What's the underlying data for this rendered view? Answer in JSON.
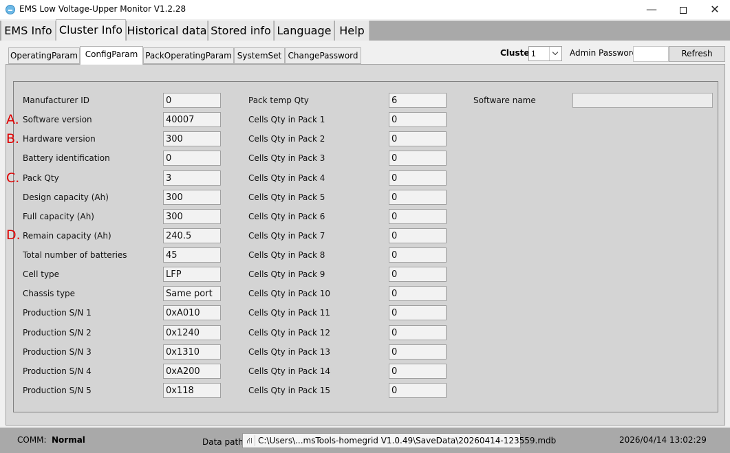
{
  "window": {
    "title": "EMS Low Voltage-Upper Monitor V1.2.28",
    "minimize_glyph": "—",
    "close_glyph": "✕"
  },
  "main_tabs": [
    {
      "label": "EMS Info"
    },
    {
      "label": "Cluster Info"
    },
    {
      "label": "Historical data"
    },
    {
      "label": "Stored info"
    },
    {
      "label": "Language"
    },
    {
      "label": "Help"
    }
  ],
  "sub_tabs": [
    {
      "label": "OperatingParam"
    },
    {
      "label": "ConfigParam"
    },
    {
      "label": "PackOperatingParam"
    },
    {
      "label": "SystemSet"
    },
    {
      "label": "ChangePassword"
    }
  ],
  "controls": {
    "cluster_label": "Cluster",
    "cluster_value": "1",
    "admin_label": "Admin Password",
    "admin_value": "",
    "refresh_label": "Refresh"
  },
  "left_fields": [
    {
      "label": "Manufacturer ID",
      "value": "0"
    },
    {
      "label": "Software version",
      "value": "40007"
    },
    {
      "label": "Hardware version",
      "value": "300"
    },
    {
      "label": "Battery identification",
      "value": "0"
    },
    {
      "label": "Pack Qty",
      "value": "3"
    },
    {
      "label": "Design capacity (Ah)",
      "value": "300"
    },
    {
      "label": "Full capacity (Ah)",
      "value": "300"
    },
    {
      "label": "Remain capacity (Ah)",
      "value": "240.5"
    },
    {
      "label": "Total number of batteries",
      "value": "45"
    },
    {
      "label": "Cell type",
      "value": "LFP"
    },
    {
      "label": "Chassis type",
      "value": "Same port"
    },
    {
      "label": "Production S/N 1",
      "value": "0xA010"
    },
    {
      "label": "Production S/N 2",
      "value": "0x1240"
    },
    {
      "label": "Production S/N 3",
      "value": "0x1310"
    },
    {
      "label": "Production S/N 4",
      "value": "0xA200"
    },
    {
      "label": "Production S/N 5",
      "value": "0x118"
    }
  ],
  "mid_fields": [
    {
      "label": "Pack temp Qty",
      "value": "6"
    },
    {
      "label": "Cells Qty in Pack 1",
      "value": "0"
    },
    {
      "label": "Cells Qty in Pack 2",
      "value": "0"
    },
    {
      "label": "Cells Qty in Pack 3",
      "value": "0"
    },
    {
      "label": "Cells Qty in Pack 4",
      "value": "0"
    },
    {
      "label": "Cells Qty in Pack 5",
      "value": "0"
    },
    {
      "label": "Cells Qty in Pack 6",
      "value": "0"
    },
    {
      "label": "Cells Qty in Pack 7",
      "value": "0"
    },
    {
      "label": "Cells Qty in Pack 8",
      "value": "0"
    },
    {
      "label": "Cells Qty in Pack 9",
      "value": "0"
    },
    {
      "label": "Cells Qty in Pack 10",
      "value": "0"
    },
    {
      "label": "Cells Qty in Pack 11",
      "value": "0"
    },
    {
      "label": "Cells Qty in Pack 12",
      "value": "0"
    },
    {
      "label": "Cells Qty in Pack 13",
      "value": "0"
    },
    {
      "label": "Cells Qty in Pack 14",
      "value": "0"
    },
    {
      "label": "Cells Qty in Pack 15",
      "value": "0"
    }
  ],
  "software_name": {
    "label": "Software name",
    "value": ""
  },
  "markers": [
    "A.",
    "B.",
    "C.",
    "D."
  ],
  "status": {
    "comm_label": "COMM:",
    "comm_value": "Normal",
    "datapath_label": "Data path:",
    "datapath_value": "C:\\Users\\...msTools-homegrid V1.0.49\\SaveData\\20260414-123559.mdb",
    "timestamp": "2026/04/14 13:02:29"
  }
}
